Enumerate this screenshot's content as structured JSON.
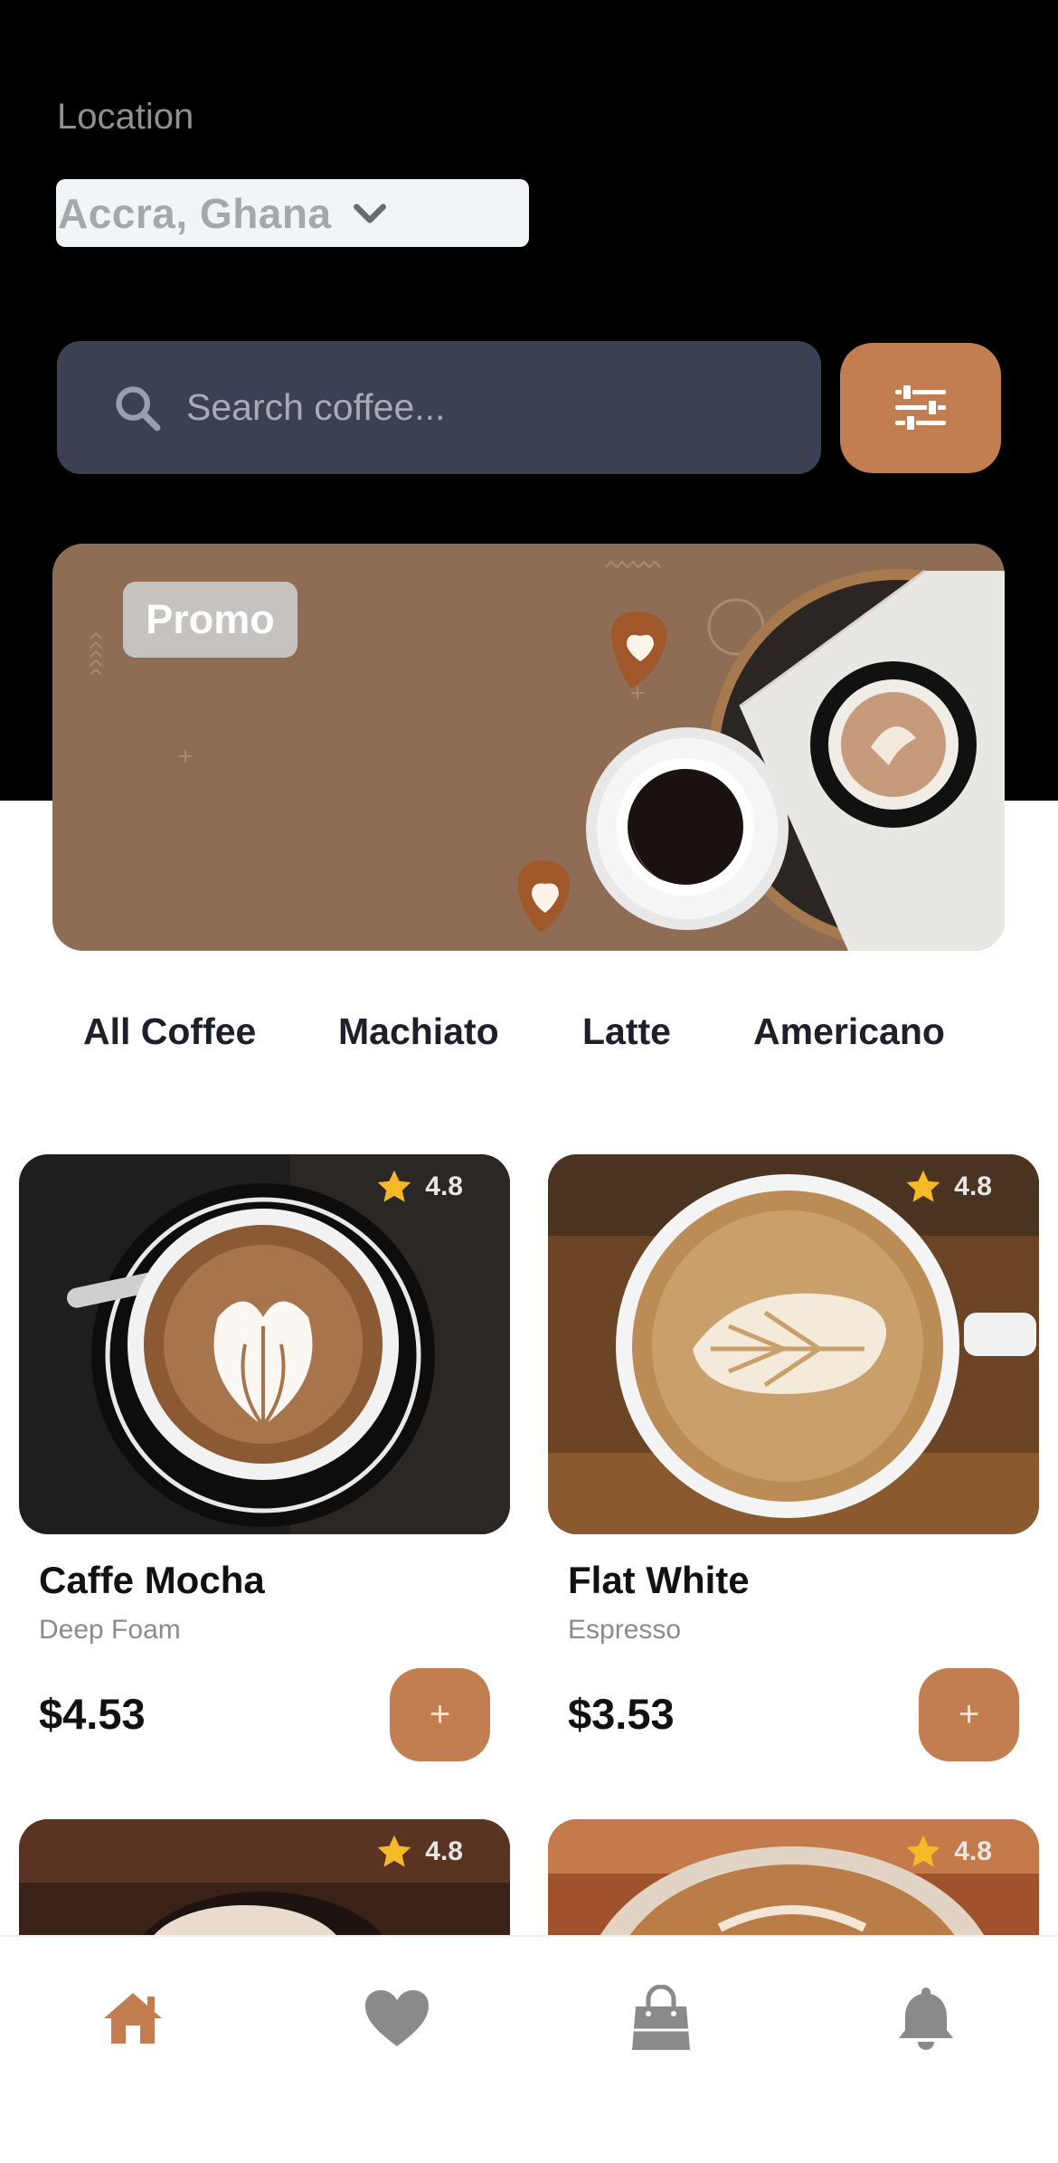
{
  "header": {
    "location_label": "Location",
    "location_value": "Accra, Ghana"
  },
  "search": {
    "placeholder": "Search coffee...",
    "icon": "search-icon",
    "filter_icon": "sliders-icon"
  },
  "promo": {
    "badge": "Promo"
  },
  "categories": [
    "All Coffee",
    "Machiato",
    "Latte",
    "Americano"
  ],
  "products": [
    {
      "name": "Caffe Mocha",
      "subtitle": "Deep Foam",
      "price": "$4.53",
      "rating": "4.8",
      "add_label": "+"
    },
    {
      "name": "Flat White",
      "subtitle": "Espresso",
      "price": "$3.53",
      "rating": "4.8",
      "add_label": "+"
    },
    {
      "rating": "4.8"
    },
    {
      "rating": "4.8"
    }
  ],
  "nav": {
    "items": [
      "home-icon",
      "heart-icon",
      "bag-icon",
      "bell-icon"
    ],
    "active": "home-icon"
  },
  "colors": {
    "accent": "#c27d51",
    "dark": "#000000",
    "search_bg": "#3b4152",
    "promo_bg": "#8e6d54",
    "inactive_icon": "#8a8a8a",
    "star": "#f7b928"
  }
}
